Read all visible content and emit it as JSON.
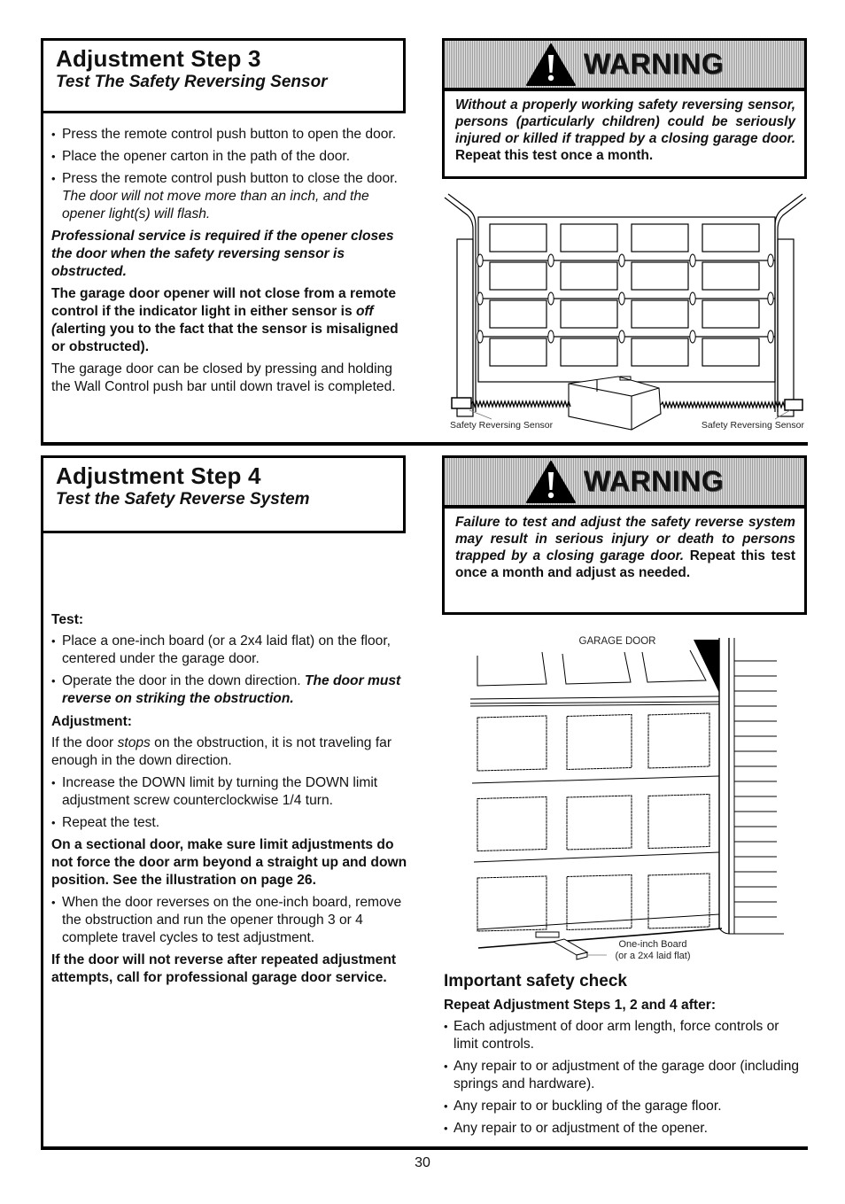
{
  "step3": {
    "title": "Adjustment Step 3",
    "subtitle": "Test The Safety Reversing Sensor",
    "bullets": [
      {
        "text": "Press the remote control push button to open the door.",
        "italic": ""
      },
      {
        "text": "Place the opener carton in the path of the door.",
        "italic": ""
      },
      {
        "text": "Press the remote control push button to close the door. ",
        "italic": "The door will not move more than an inch, and the opener light(s) will flash."
      }
    ],
    "professional_note": "Professional service is required if the opener closes the door when the safety reversing sensor is obstructed.",
    "indicator_note_a": "The garage door opener will not close from a remote control if the indicator light in either sensor  is ",
    "indicator_note_off": "off (",
    "indicator_note_b": "alerting you to the fact that the sensor is misaligned or obstructed).",
    "wall_control_note": "The garage door can be closed by pressing and holding the Wall Control push bar until down travel is completed."
  },
  "warning1": {
    "label": "WARNING",
    "icon": "warning-triangle-icon",
    "italic_text": "Without a properly working safety reversing sensor, persons (particularly children) could be seriously injured or killed if trapped by a closing garage door.",
    "plain_text": " Repeat this test once a month."
  },
  "figure1": {
    "left_label": "Safety Reversing Sensor",
    "right_label": "Safety Reversing Sensor"
  },
  "step4": {
    "title": "Adjustment Step 4",
    "subtitle": "Test the Safety Reverse System",
    "test_heading": "Test:",
    "test_bullets": [
      {
        "text": "Place a one-inch board (or a 2x4 laid flat) on the floor, centered under the garage door.",
        "emph": ""
      },
      {
        "text": "Operate the door in the down direction. ",
        "emph": "The door must reverse on striking the obstruction."
      }
    ],
    "adjustment_heading": "Adjustment:",
    "adjustment_intro_a": "If the door ",
    "adjustment_intro_stops": "stops",
    "adjustment_intro_b": " on the obstruction, it is not traveling far enough in the down direction.",
    "adjustment_bullets": [
      "Increase the DOWN limit by turning the DOWN limit adjustment screw counterclockwise 1/4 turn.",
      "Repeat the test."
    ],
    "sectional_note": "On a sectional door, make sure limit adjustments do not force the door arm beyond a straight up and down position. See the illustration on page 26.",
    "reverse_bullet": "When the door reverses on the one-inch board, remove the obstruction and run the opener through 3 or 4 complete travel cycles to test adjustment.",
    "service_note": "If the door will not reverse after repeated adjustment attempts, call for professional garage door service."
  },
  "warning2": {
    "label": "WARNING",
    "icon": "warning-triangle-icon",
    "italic_text": "Failure to test and adjust the safety reverse system may result in serious injury or death to persons trapped by a closing garage door.",
    "plain_text": " Repeat this test once a month and adjust as needed."
  },
  "figure2": {
    "door_label": "GARAGE DOOR",
    "board_label_1": "One-inch Board",
    "board_label_2": "(or a 2x4 laid flat)"
  },
  "safety_check": {
    "title": "Important safety check",
    "subtitle": "Repeat Adjustment Steps 1, 2 and 4 after:",
    "items": [
      "Each adjustment of door arm length,  force controls or limit controls.",
      "Any repair to or adjustment of the garage door (including springs and hardware).",
      "Any repair to or buckling of the garage floor.",
      "Any repair to or adjustment of the opener."
    ]
  },
  "page_number": "30"
}
